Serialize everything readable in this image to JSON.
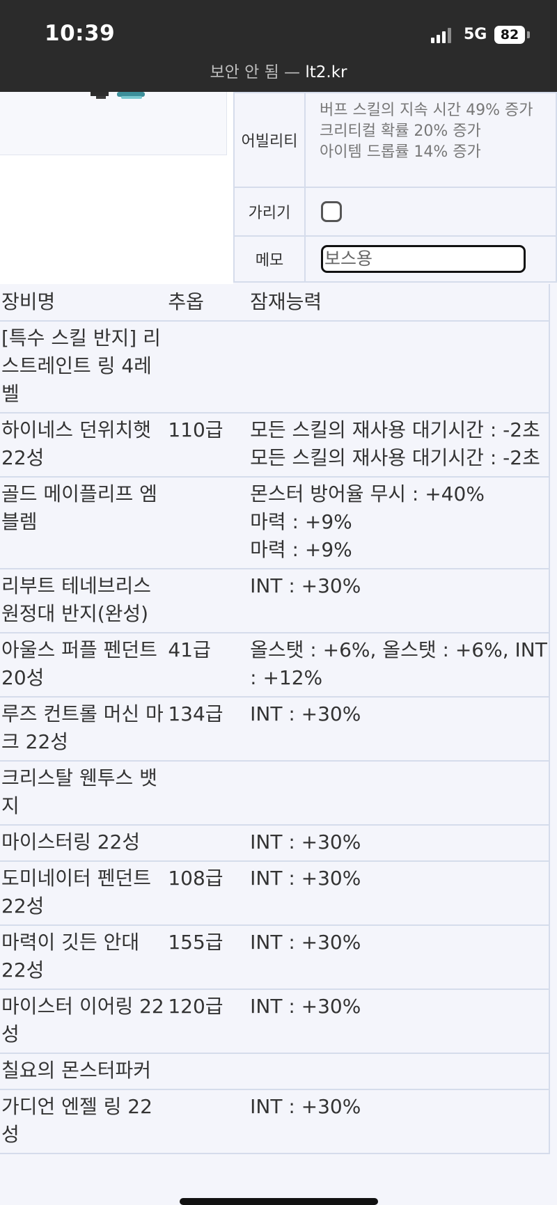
{
  "status_bar": {
    "time": "10:39",
    "network": "5G",
    "battery": "82"
  },
  "browser": {
    "insecure_label": "보안 안 됨 —",
    "host": "lt2.kr"
  },
  "info": {
    "ability_label": "어빌리티",
    "ability_lines": [
      "버프 스킬의 지속 시간 49% 증가",
      "크리티컬 확률 20% 증가",
      "아이템 드롭률 14% 증가"
    ],
    "hide_label": "가리기",
    "hide_checked": false,
    "memo_label": "메모",
    "memo_value": "보스용"
  },
  "equipment": {
    "headers": {
      "name": "장비명",
      "star": "추옵",
      "potential": "잠재능력"
    },
    "rows": [
      {
        "name": "[특수 스킬 반지] 리스트레인트 링 4레벨",
        "star": "",
        "potential": ""
      },
      {
        "name": "하이네스 던위치햇 22성",
        "star": "110급",
        "potential": "모든 스킬의 재사용 대기시간 : -2초\n모든 스킬의 재사용 대기시간 : -2초"
      },
      {
        "name": "골드 메이플리프 엠블렘",
        "star": "",
        "potential": "몬스터 방어율 무시 : +40%\n마력 : +9%\n마력 : +9%"
      },
      {
        "name": "리부트 테네브리스 원정대 반지(완성)",
        "star": "",
        "potential": "INT : +30%"
      },
      {
        "name": "아울스 퍼플 펜던트 20성",
        "star": "41급",
        "potential": "올스탯 : +6%, 올스탯 : +6%, INT : +12%"
      },
      {
        "name": "루즈 컨트롤 머신 마크 22성",
        "star": "134급",
        "potential": "INT : +30%"
      },
      {
        "name": "크리스탈 웬투스 뱃지",
        "star": "",
        "potential": ""
      },
      {
        "name": "마이스터링 22성",
        "star": "",
        "potential": "INT : +30%"
      },
      {
        "name": "도미네이터 펜던트 22성",
        "star": "108급",
        "potential": "INT : +30%"
      },
      {
        "name": "마력이 깃든 안대 22성",
        "star": "155급",
        "potential": "INT : +30%"
      },
      {
        "name": "마이스터 이어링 22성",
        "star": "120급",
        "potential": "INT : +30%"
      },
      {
        "name": "칠요의 몬스터파커",
        "star": "",
        "potential": ""
      },
      {
        "name": "가디언 엔젤 링 22성",
        "star": "",
        "potential": "INT : +30%"
      }
    ]
  }
}
